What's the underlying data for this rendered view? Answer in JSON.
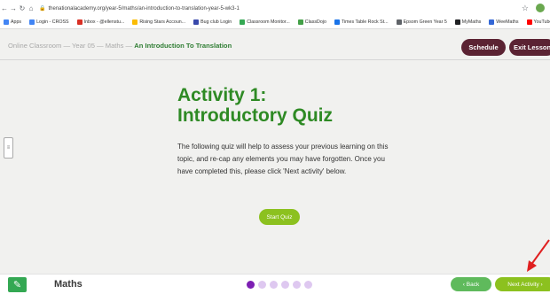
{
  "browser": {
    "url": "thenationalacademy.org/year-5/maths/an-introduction-to-translation-year-5-wk3-1",
    "bookmarks": [
      {
        "label": "Apps",
        "color": "#4285f4"
      },
      {
        "label": "Login - CROSS",
        "color": "#4285f4"
      },
      {
        "label": "Inbox - @ellenstu...",
        "color": "#d93025"
      },
      {
        "label": "Rising Stars Accoun...",
        "color": "#fbbc04"
      },
      {
        "label": "Bug club Login",
        "color": "#3949ab"
      },
      {
        "label": "Classroom Monitor...",
        "color": "#34a853"
      },
      {
        "label": "ClassDojo",
        "color": "#43a047"
      },
      {
        "label": "Times Table Rock St...",
        "color": "#1a73e8"
      },
      {
        "label": "Epsom Green Year 5",
        "color": "#5f6368"
      },
      {
        "label": "MyMaths",
        "color": "#202124"
      },
      {
        "label": "WeeMaths",
        "color": "#3367d6"
      },
      {
        "label": "YouTube",
        "color": "#ff0000"
      }
    ]
  },
  "breadcrumb": {
    "path": "Online Classroom — Year 05 — Maths —",
    "current": "An Introduction To Translation"
  },
  "header": {
    "schedule_label": "Schedule",
    "exit_label": "Exit Lesson"
  },
  "main": {
    "title_line1": "Activity 1:",
    "title_line2": "Introductory Quiz",
    "description": "The following quiz will help to assess your previous learning on this topic, and re-cap any elements you may have forgotten. Once you have completed this, please click 'Next activity' below.",
    "start_label": "Start Quiz"
  },
  "footer": {
    "subject": "Maths",
    "progress_total": 6,
    "progress_current": 1,
    "back_label": "Back",
    "next_label": "Next Activity"
  },
  "colors": {
    "title_green": "#2e8a24",
    "button_lime": "#8cc11f",
    "button_maroon": "#5b2333",
    "dot_active": "#7d1fb3",
    "annotation_red": "#e02020"
  },
  "icons": {
    "browser_back": "arrow-left-icon",
    "browser_forward": "arrow-right-icon",
    "browser_reload": "reload-icon",
    "browser_home": "home-icon",
    "site_logo": "pencil-icon",
    "annotation": "red-arrow-icon"
  }
}
